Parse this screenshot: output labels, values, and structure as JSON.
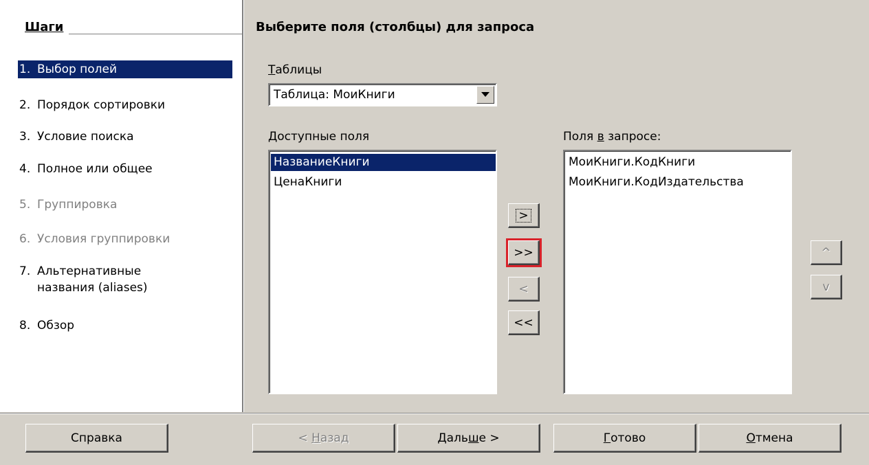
{
  "steps_panel": {
    "title": "Шаги",
    "items": [
      {
        "num": "1.",
        "label": "Выбор полей",
        "state": "active"
      },
      {
        "num": "2.",
        "label": "Порядок сортировки",
        "state": "enabled"
      },
      {
        "num": "3.",
        "label": "Условие поиска",
        "state": "enabled"
      },
      {
        "num": "4.",
        "label": "Полное или общее",
        "state": "enabled"
      },
      {
        "num": "5.",
        "label": "Группировка",
        "state": "disabled"
      },
      {
        "num": "6.",
        "label": "Условия группировки",
        "state": "disabled"
      },
      {
        "num": "7.",
        "label_line1": "Альтернативные",
        "label_line2": "названия (aliases)",
        "state": "enabled"
      },
      {
        "num": "8.",
        "label": "Обзор",
        "state": "enabled"
      }
    ]
  },
  "main": {
    "heading": "Выберите поля (столбцы) для запроса",
    "tables_label_first": "Т",
    "tables_label_rest": "аблицы",
    "tables_select_value": "Таблица: МоиКниги",
    "available_label_first": "Д",
    "available_label_rest": "оступные поля",
    "available_fields": [
      "НазваниеКниги",
      "ЦенаКниги"
    ],
    "query_label_a": "Поля ",
    "query_label_u": "в",
    "query_label_b": " запросе:",
    "query_fields": [
      "МоиКниги.КодКниги",
      "МоиКниги.КодИздательства"
    ],
    "transfer_buttons": {
      "move_one": ">",
      "move_all": ">>",
      "remove_one": "<",
      "remove_all": "<<"
    },
    "order_buttons": {
      "up": "^",
      "down": "v"
    }
  },
  "footer": {
    "help": "Справка",
    "back_a": "< ",
    "back_u": "Н",
    "back_b": "азад",
    "next_a": "Даль",
    "next_u": "ш",
    "next_b": "е >",
    "finish_u": "Г",
    "finish_b": "отово",
    "cancel_u": "О",
    "cancel_b": "тмена"
  },
  "colors": {
    "dialog_bg": "#d4d0c8",
    "selection": "#0a246a",
    "highlight_box": "#d9222a",
    "disabled_text": "#808080"
  }
}
